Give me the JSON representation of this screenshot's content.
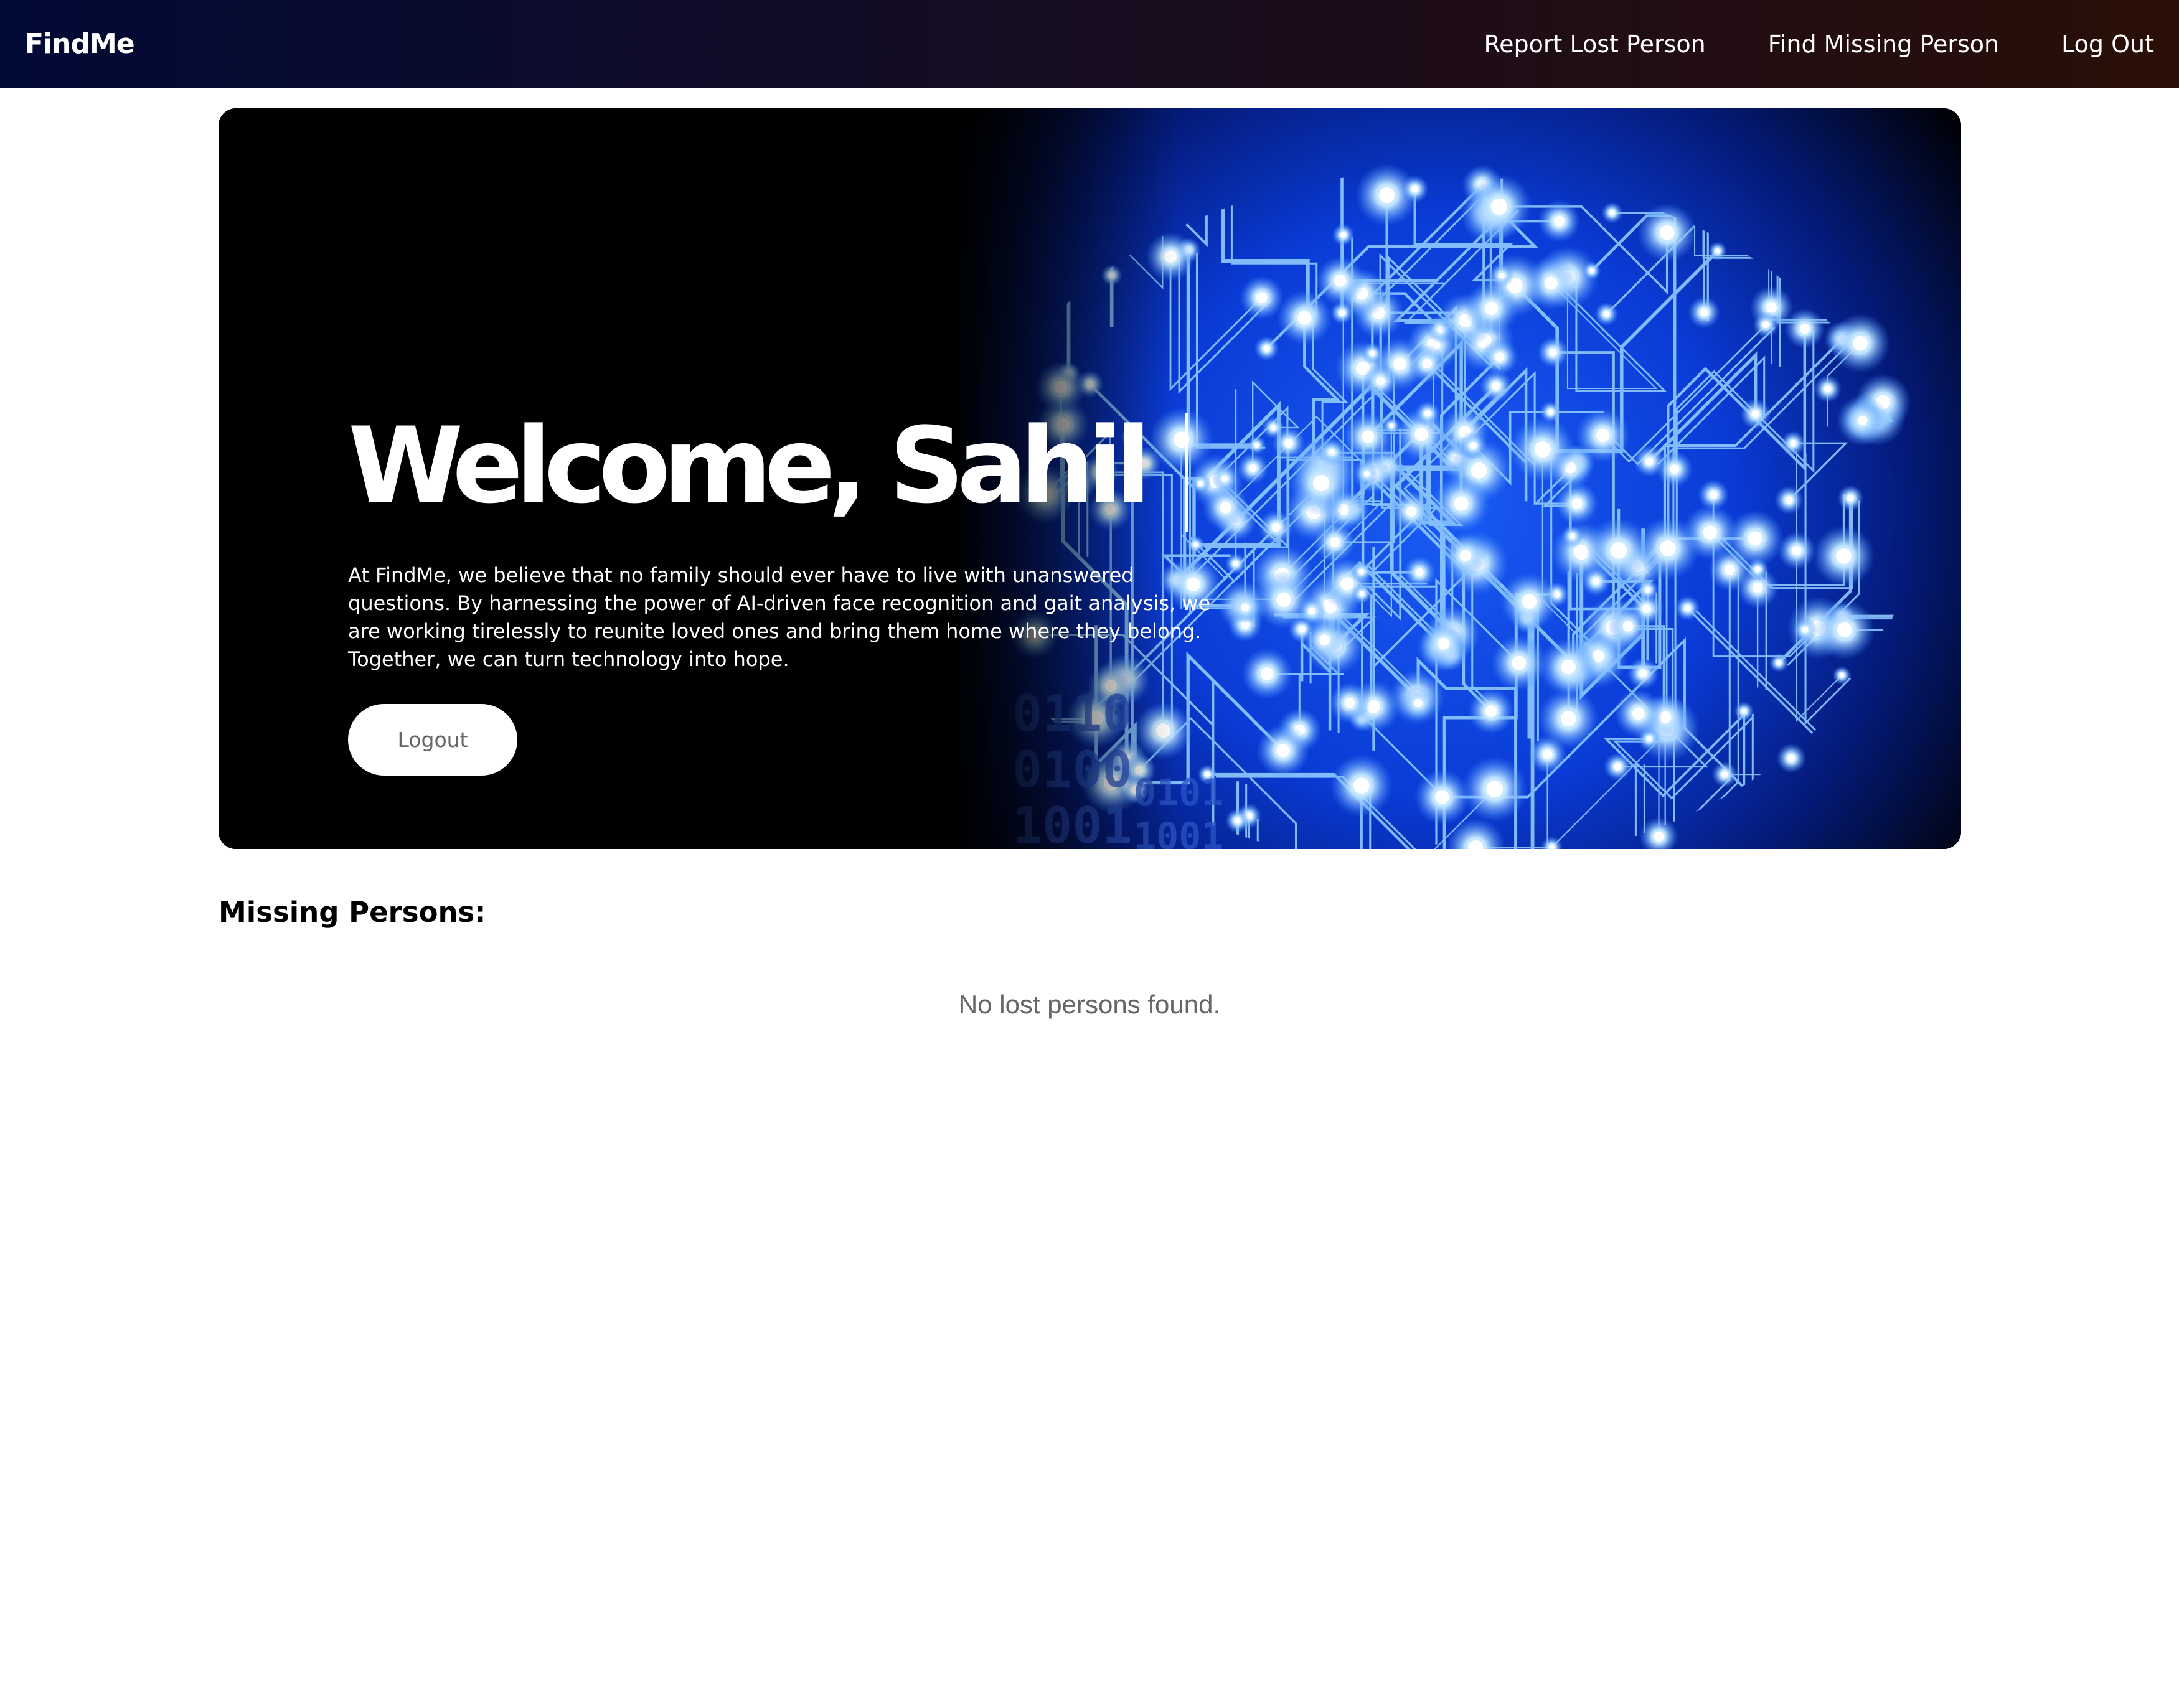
{
  "navbar": {
    "brand": "FindMe",
    "links": [
      {
        "label": "Report Lost Person"
      },
      {
        "label": "Find Missing Person"
      },
      {
        "label": "Log Out"
      }
    ]
  },
  "hero": {
    "title": "Welcome, Sahil",
    "description": "At FindMe, we believe that no family should ever have to live with unanswered questions. By harnessing the power of AI-driven face recognition and gait analysis, we are working tirelessly to reunite loved ones and bring them home where they belong. Together, we can turn technology into hope.",
    "logout_label": "Logout",
    "binary_digits": [
      "0110",
      "0100",
      "0101",
      "1001",
      "1001"
    ],
    "colors": {
      "glow": "#1e64ff",
      "circuit": "#7fc0ff",
      "background": "#000000"
    }
  },
  "missing": {
    "title": "Missing Persons:",
    "empty_message": "No lost persons found."
  }
}
